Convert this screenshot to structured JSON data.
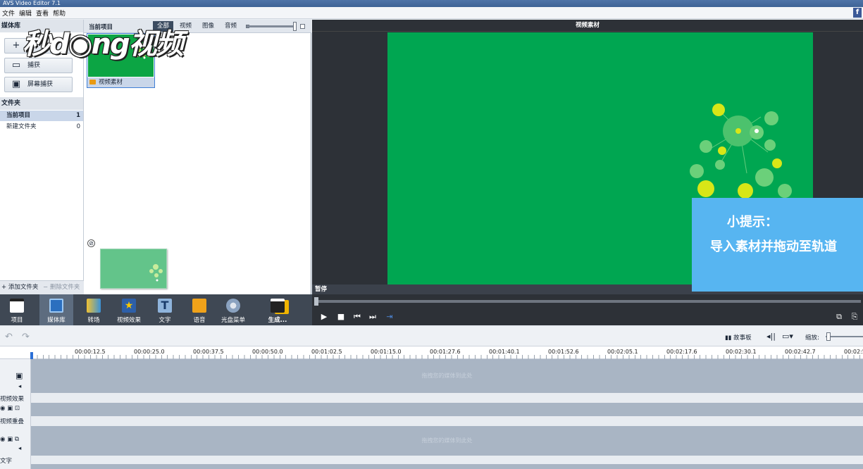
{
  "app": {
    "title": "AVS Video Editor 7.1"
  },
  "menu": [
    "文件",
    "编辑",
    "查看",
    "帮助"
  ],
  "watermark": "秒d◉ng视频",
  "left_panel": {
    "header": "媒体库",
    "add_label": "+",
    "capture_label": "捕获",
    "screen_capture_label": "屏幕捕获",
    "folders_header": "文件夹",
    "folders": [
      {
        "name": "当前项目",
        "count": "1"
      },
      {
        "name": "新建文件夹",
        "count": "0"
      }
    ],
    "add_folder": "添加文件夹",
    "delete_folder": "删除文件夹"
  },
  "media_panel": {
    "header": "当前项目",
    "filter_tabs": [
      "全部",
      "视频",
      "图像",
      "音频"
    ],
    "thumbnail_label": "视频素材"
  },
  "preview": {
    "header": "视频素材",
    "status": "暂停"
  },
  "tip": {
    "line1": "小提示：",
    "line2": "导入素材并拖动至轨道"
  },
  "toolbar": [
    {
      "label": "项目",
      "icon": "clapperboard-icon"
    },
    {
      "label": "媒体库",
      "icon": "media-library-icon"
    },
    {
      "label": "转场",
      "icon": "transition-icon"
    },
    {
      "label": "视频效果",
      "icon": "video-effect-icon"
    },
    {
      "label": "文字",
      "icon": "text-icon"
    },
    {
      "label": "语音",
      "icon": "voice-icon"
    },
    {
      "label": "光盘菜单",
      "icon": "disc-menu-icon"
    },
    {
      "label": "生成...",
      "icon": "produce-icon"
    }
  ],
  "timeline": {
    "storyboard_label": "故事板",
    "zoom_label": "缩放:",
    "ticks": [
      "00:00:12.5",
      "00:00:25.0",
      "00:00:37.5",
      "00:00:50.0",
      "00:01:02.5",
      "00:01:15.0",
      "00:01:27.6",
      "00:01:40.1",
      "00:01:52.6",
      "00:02:05.1",
      "00:02:17.6",
      "00:02:30.1",
      "00:02:42.7",
      "00:02:5"
    ],
    "track_labels": {
      "effects": "视频效果",
      "overlay": "视频重叠",
      "text": "文字"
    },
    "drop_hint": "拖拽您的媒体到此处"
  },
  "colors": {
    "video_bg": "#00a651",
    "tip_bg": "#57b5f1",
    "toolbar_bg": "#3f4854"
  }
}
